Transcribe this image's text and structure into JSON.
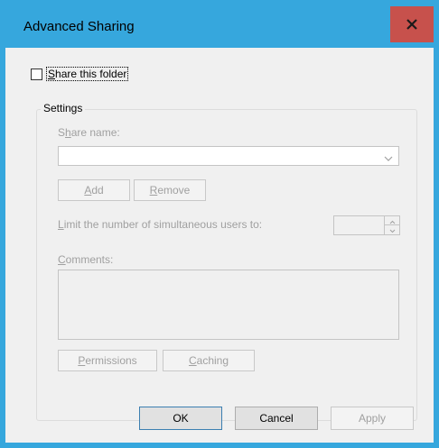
{
  "window": {
    "title": "Advanced Sharing",
    "close_glyph": "x"
  },
  "share_checkbox": {
    "label_prefix": "",
    "label_mnemonic": "S",
    "label_rest": "hare this folder",
    "checked": false
  },
  "settings": {
    "group_title": "Settings",
    "share_name_label": {
      "pre": "S",
      "mn": "h",
      "post": "are name:"
    },
    "share_name_value": "",
    "add_button": {
      "pre": "",
      "mn": "A",
      "post": "dd"
    },
    "remove_button": {
      "pre": "",
      "mn": "R",
      "post": "emove"
    },
    "limit_label": {
      "pre": "",
      "mn": "L",
      "post": "imit the number of simultaneous users to:"
    },
    "limit_value": "",
    "comments_label": {
      "pre": "",
      "mn": "C",
      "post": "omments:"
    },
    "comments_value": "",
    "permissions_button": {
      "pre": "",
      "mn": "P",
      "post": "ermissions"
    },
    "caching_button": {
      "pre": "",
      "mn": "C",
      "post": "aching"
    }
  },
  "footer": {
    "ok_label": "OK",
    "cancel_label": "Cancel",
    "apply_label": "Apply"
  },
  "colors": {
    "titlebar": "#36a7dd",
    "close_button": "#c7514c",
    "disabled_text": "#a0a0a0",
    "dialog_background": "#f0f0f0"
  },
  "icons": {
    "close": "close-icon",
    "dropdown": "chevron-down-icon",
    "spin_up": "chevron-up-icon",
    "spin_down": "chevron-down-icon"
  }
}
